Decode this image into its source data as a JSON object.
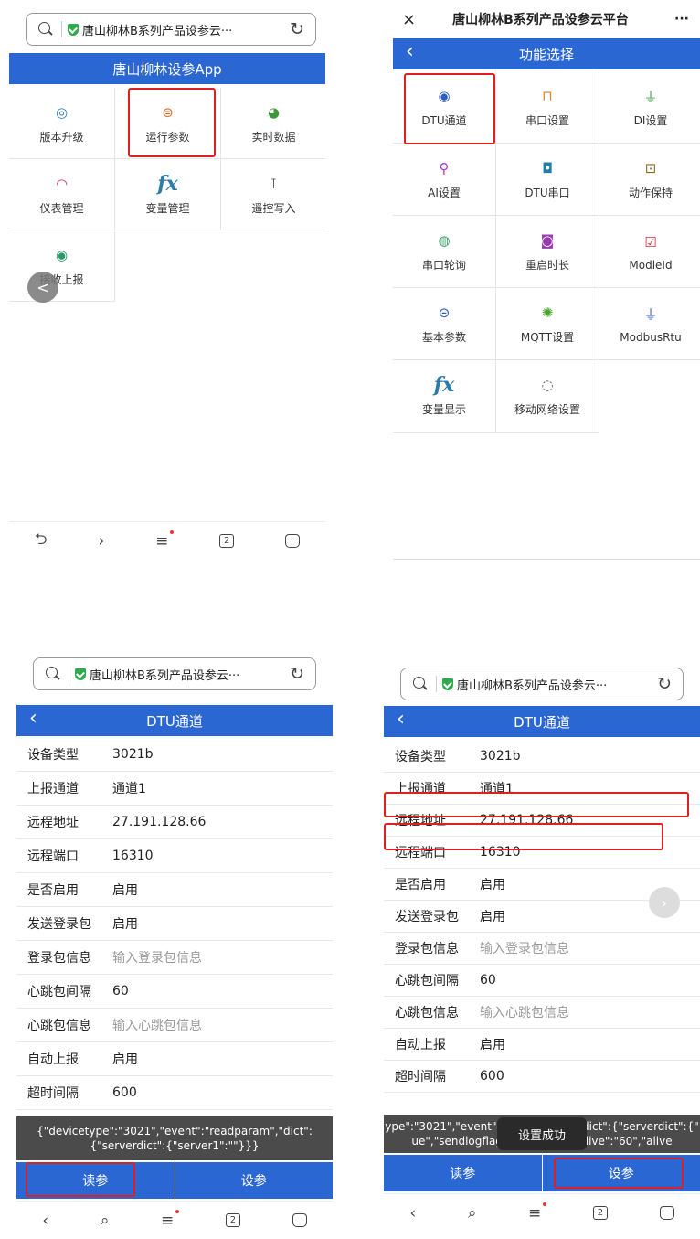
{
  "panel1": {
    "url_title": "唐山柳林B系列产品设参云···",
    "app_title": "唐山柳林设参App",
    "grid": [
      {
        "label": "版本升级",
        "icon": "eye-icon"
      },
      {
        "label": "运行参数",
        "icon": "params-icon"
      },
      {
        "label": "实时数据",
        "icon": "pie-icon"
      },
      {
        "label": "仪表管理",
        "icon": "gauge-icon"
      },
      {
        "label": "变量管理",
        "icon": "fx-icon",
        "glyph": "fx"
      },
      {
        "label": "遥控写入",
        "icon": "remote-icon"
      },
      {
        "label": "接收上报",
        "icon": "receive-icon"
      }
    ]
  },
  "panel2": {
    "window_title": "唐山柳林B系列产品设参云平台",
    "close_glyph": "×",
    "more_glyph": "···",
    "page_title": "功能选择",
    "grid": [
      {
        "label": "DTU通道",
        "icon": "dtu-icon"
      },
      {
        "label": "串口设置",
        "icon": "serial-icon"
      },
      {
        "label": "DI设置",
        "icon": "di-icon"
      },
      {
        "label": "AI设置",
        "icon": "ai-icon"
      },
      {
        "label": "DTU串口",
        "icon": "dtu-serial-icon"
      },
      {
        "label": "动作保持",
        "icon": "hold-icon"
      },
      {
        "label": "串口轮询",
        "icon": "poll-icon"
      },
      {
        "label": "重启时长",
        "icon": "restart-icon"
      },
      {
        "label": "ModleId",
        "icon": "model-icon"
      },
      {
        "label": "基本参数",
        "icon": "basic-icon"
      },
      {
        "label": "MQTT设置",
        "icon": "mqtt-icon"
      },
      {
        "label": "ModbusRtu",
        "icon": "modbus-icon"
      },
      {
        "label": "变量显示",
        "icon": "fx-icon",
        "glyph": "fx"
      },
      {
        "label": "移动网络设置",
        "icon": "network-icon"
      }
    ]
  },
  "panel3": {
    "url_title": "唐山柳林B系列产品设参云···",
    "page_title": "DTU通道",
    "rows": [
      {
        "label": "设备类型",
        "value": "3021b"
      },
      {
        "label": "上报通道",
        "value": "通道1"
      },
      {
        "label": "远程地址",
        "value": "27.191.128.66"
      },
      {
        "label": "远程端口",
        "value": "16310"
      },
      {
        "label": "是否启用",
        "value": "启用"
      },
      {
        "label": "发送登录包",
        "value": "启用"
      },
      {
        "label": "登录包信息",
        "placeholder": "输入登录包信息"
      },
      {
        "label": "心跳包间隔",
        "value": "60"
      },
      {
        "label": "心跳包信息",
        "placeholder": "输入心跳包信息"
      },
      {
        "label": "自动上报",
        "value": "启用"
      },
      {
        "label": "超时间隔",
        "value": "600"
      }
    ],
    "toast_line1": "{\"devicetype\":\"3021\",\"event\":\"readparam\",\"dict\":",
    "toast_line2": "{\"serverdict\":{\"server1\":\"\"}}}",
    "read_button": "读参",
    "set_button": "设参"
  },
  "panel4": {
    "url_title": "唐山柳林B系列产品设参云···",
    "page_title": "DTU通道",
    "rows": [
      {
        "label": "设备类型",
        "value": "3021b"
      },
      {
        "label": "上报通道",
        "value": "通道1"
      },
      {
        "label": "远程地址",
        "value": "27.191.128.66"
      },
      {
        "label": "远程端口",
        "value": "16310"
      },
      {
        "label": "是否启用",
        "value": "启用"
      },
      {
        "label": "发送登录包",
        "value": "启用"
      },
      {
        "label": "登录包信息",
        "placeholder": "输入登录包信息"
      },
      {
        "label": "心跳包间隔",
        "value": "60"
      },
      {
        "label": "心跳包信息",
        "placeholder": "输入心跳包信息"
      },
      {
        "label": "自动上报",
        "value": "启用"
      },
      {
        "label": "超时间隔",
        "value": "600"
      }
    ],
    "toast_line1": "ype\":\"3021\",\"event\":\"writeparam\",\"dict\":{\"serverdict\":{\"",
    "toast_line2": "ue\",\"sendlogflag\":\"true\",\"keepalive\":\"60\",\"alive",
    "success_toast": "设置成功",
    "read_button": "读参",
    "set_button": "设参"
  },
  "nav": {
    "tabs_count": "2"
  },
  "colors": {
    "accent": "#2b67d2",
    "highlight": "#e02020"
  }
}
